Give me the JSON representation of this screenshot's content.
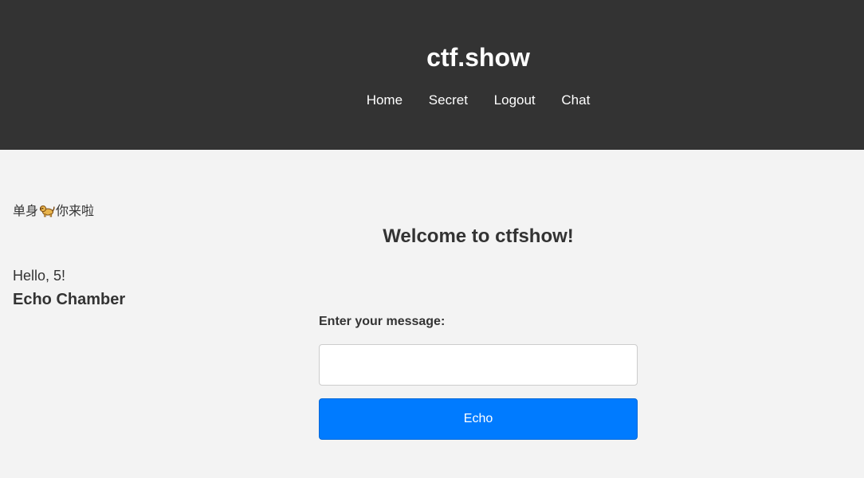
{
  "header": {
    "site_title": "ctf.show",
    "nav": [
      {
        "label": "Home"
      },
      {
        "label": "Secret"
      },
      {
        "label": "Logout"
      },
      {
        "label": "Chat"
      }
    ]
  },
  "tagline": {
    "before": "单身",
    "icon": "dog-icon",
    "after": "你来啦"
  },
  "welcome": "Welcome to ctfshow!",
  "user": {
    "greeting": "Hello, 5!"
  },
  "chamber": {
    "title": "Echo Chamber",
    "label": "Enter your message:",
    "input_value": "",
    "input_placeholder": "",
    "button_label": "Echo"
  },
  "colors": {
    "header_bg": "#333333",
    "page_bg": "#f3f3f3",
    "accent": "#007bff"
  }
}
